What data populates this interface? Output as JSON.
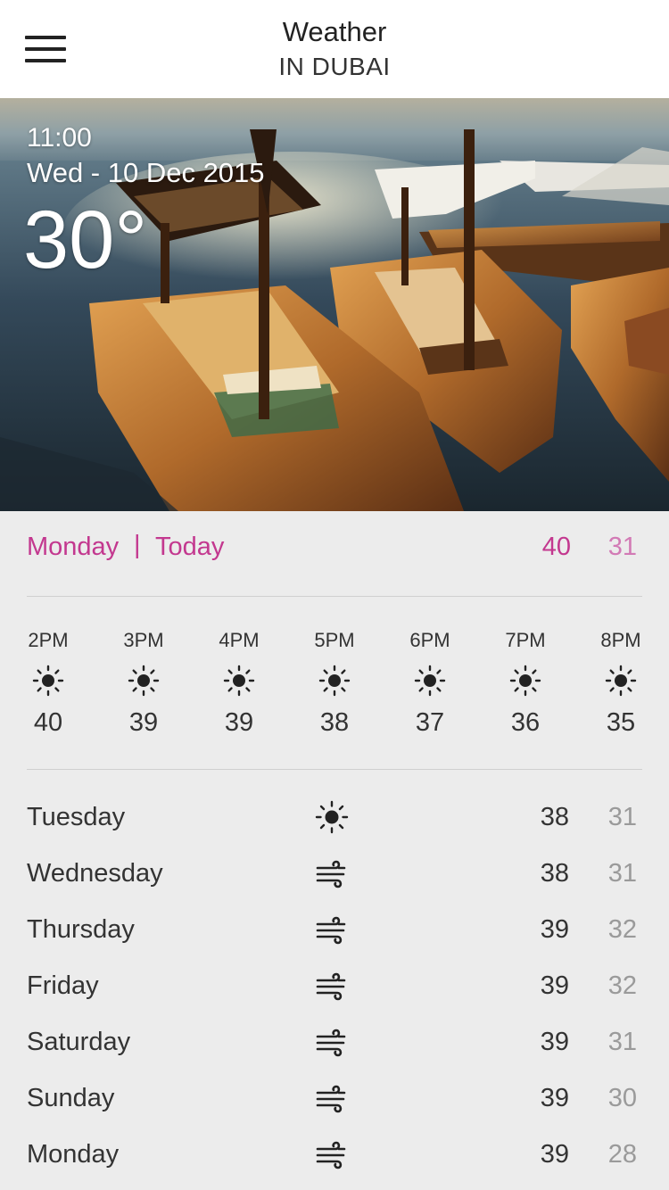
{
  "header": {
    "title": "Weather",
    "subtitle": "IN DUBAI",
    "menu_icon": "hamburger-menu-icon"
  },
  "hero": {
    "time": "11:00",
    "date": "Wed - 10 Dec 2015",
    "temperature": "30°"
  },
  "today": {
    "day": "Monday",
    "separator": "|",
    "label": "Today",
    "high": "40",
    "low": "31",
    "accent_color": "#c3388f"
  },
  "hourly": [
    {
      "time": "2PM",
      "icon": "sun-icon",
      "temp": "40"
    },
    {
      "time": "3PM",
      "icon": "sun-icon",
      "temp": "39"
    },
    {
      "time": "4PM",
      "icon": "sun-icon",
      "temp": "39"
    },
    {
      "time": "5PM",
      "icon": "sun-icon",
      "temp": "38"
    },
    {
      "time": "6PM",
      "icon": "sun-icon",
      "temp": "37"
    },
    {
      "time": "7PM",
      "icon": "sun-icon",
      "temp": "36"
    },
    {
      "time": "8PM",
      "icon": "sun-icon",
      "temp": "35"
    }
  ],
  "forecast": [
    {
      "day": "Tuesday",
      "icon": "sun-icon",
      "high": "38",
      "low": "31"
    },
    {
      "day": "Wednesday",
      "icon": "wind-icon",
      "high": "38",
      "low": "31"
    },
    {
      "day": "Thursday",
      "icon": "wind-icon",
      "high": "39",
      "low": "32"
    },
    {
      "day": "Friday",
      "icon": "wind-icon",
      "high": "39",
      "low": "32"
    },
    {
      "day": "Saturday",
      "icon": "wind-icon",
      "high": "39",
      "low": "31"
    },
    {
      "day": "Sunday",
      "icon": "wind-icon",
      "high": "39",
      "low": "30"
    },
    {
      "day": "Monday",
      "icon": "wind-icon",
      "high": "39",
      "low": "28"
    }
  ]
}
